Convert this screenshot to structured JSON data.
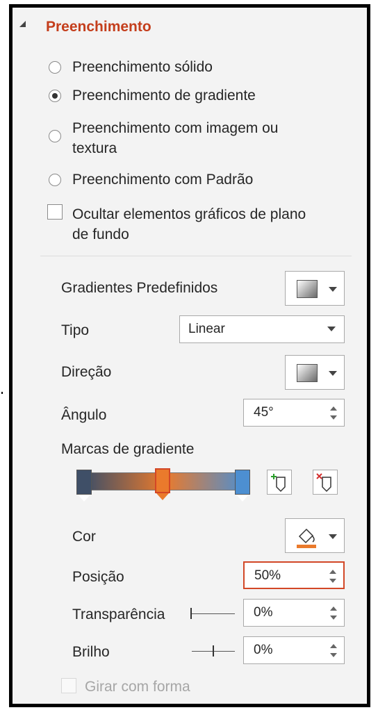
{
  "panel": {
    "section_title": "Preenchimento",
    "fill_options": [
      {
        "label": "Preenchimento sólido",
        "selected": false
      },
      {
        "label": "Preenchimento de gradiente",
        "selected": true
      },
      {
        "label_line1": "Preenchimento com imagem ou",
        "label_line2": "textura",
        "selected": false
      },
      {
        "label": "Preenchimento com Padrão",
        "selected": false
      }
    ],
    "hide_background": {
      "label_line1": "Ocultar elementos gráficos de plano",
      "label_line2": "de fundo",
      "checked": false
    },
    "preset_gradients": {
      "label": "Gradientes Predefinidos",
      "icon": "gradient-swatch-icon"
    },
    "type": {
      "label": "Tipo",
      "value": "Linear"
    },
    "direction": {
      "label": "Direção",
      "icon": "gradient-swatch-icon"
    },
    "angle": {
      "label": "Ângulo",
      "value": "45°"
    },
    "gradient_stops": {
      "label": "Marcas de gradiente",
      "stops": [
        {
          "color": "#3f4f67",
          "position_percent": 0
        },
        {
          "color": "#ea7a2c",
          "position_percent": 50,
          "selected": true
        },
        {
          "color": "#4d8fd1",
          "position_percent": 100
        }
      ],
      "add_icon": "add-gradient-stop-icon",
      "remove_icon": "remove-gradient-stop-icon"
    },
    "color": {
      "label": "Cor",
      "icon": "paint-bucket-icon",
      "value_color": "#ea7a2c"
    },
    "position": {
      "label": "Posição",
      "value": "50%"
    },
    "transparency": {
      "label": "Transparência",
      "value": "0%",
      "slider_fraction": 0
    },
    "brightness": {
      "label": "Brilho",
      "value": "0%",
      "slider_fraction": 0.5
    },
    "rotate_with_shape": {
      "label": "Girar com forma",
      "checked": false,
      "disabled": true
    },
    "accent_color": "#c43e1c"
  }
}
